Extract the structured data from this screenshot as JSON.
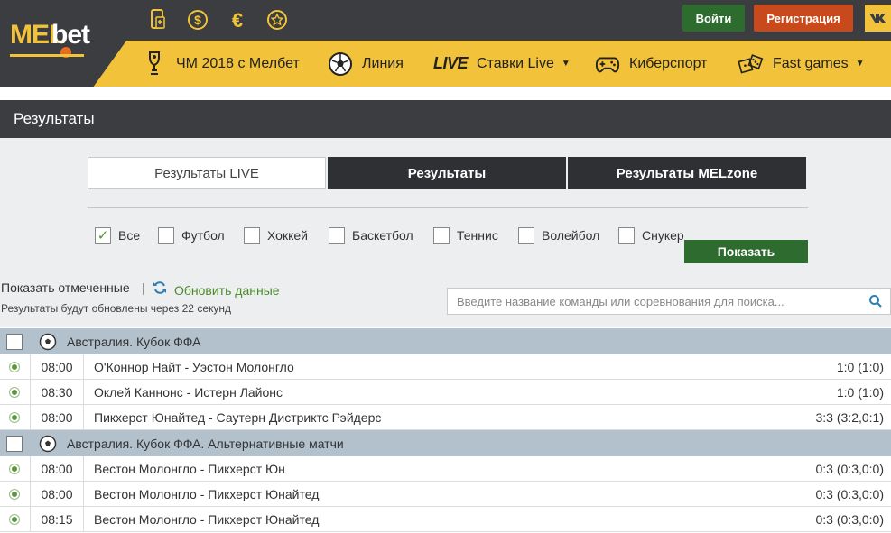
{
  "header": {
    "logo": {
      "mel": "MEL",
      "bet": "bet"
    },
    "top_icons": [
      "mobile-app-icon",
      "dollar-icon",
      "euro-icon",
      "star-icon"
    ],
    "login_label": "Войти",
    "register_label": "Регистрация",
    "vk_label": "VK",
    "nav": [
      {
        "label": "ЧМ 2018 с Мелбет",
        "icon": "trophy-icon"
      },
      {
        "label": "Линия",
        "icon": "soccer-ball-icon"
      },
      {
        "live_word": "LIVE",
        "label": "Ставки Live",
        "has_caret": true
      },
      {
        "label": "Киберспорт",
        "icon": "gamepad-icon"
      },
      {
        "label": "Fast games",
        "icon": "dice-icon",
        "has_caret": true
      }
    ]
  },
  "results": {
    "title": "Результаты",
    "tabs": [
      "Результаты LIVE",
      "Результаты",
      "Результаты MELzone"
    ],
    "filters": [
      {
        "label": "Все",
        "checked": true
      },
      {
        "label": "Футбол",
        "checked": false
      },
      {
        "label": "Хоккей",
        "checked": false
      },
      {
        "label": "Баскетбол",
        "checked": false
      },
      {
        "label": "Теннис",
        "checked": false
      },
      {
        "label": "Волейбол",
        "checked": false
      },
      {
        "label": "Снукер",
        "checked": false
      }
    ],
    "show_button": "Показать",
    "show_marked": "Показать отмеченные",
    "separator": "|",
    "refresh_label": "Обновить данные",
    "update_note": "Результаты будут обновлены через 22 секунд",
    "search_placeholder": "Введите название команды или соревнования для поиска..."
  },
  "groups": [
    {
      "name": "Австралия. Кубок ФФА",
      "matches": [
        {
          "time": "08:00",
          "teams": "О'Коннор Найт - Уэстон Молонгло",
          "score": "1:0 (1:0)"
        },
        {
          "time": "08:30",
          "teams": "Оклей Каннонс - Истерн Лайонс",
          "score": "1:0 (1:0)"
        },
        {
          "time": "08:00",
          "teams": "Пикхерст Юнайтед - Саутерн Дистриктс Рэйдерс",
          "score": "3:3 (3:2,0:1)"
        }
      ]
    },
    {
      "name": "Австралия. Кубок ФФА. Альтернативные матчи",
      "matches": [
        {
          "time": "08:00",
          "teams": "Вестон Молонгло - Пикхерст Юн",
          "score": "0:3 (0:3,0:0)"
        },
        {
          "time": "08:00",
          "teams": "Вестон Молонгло - Пикхерст Юнайтед",
          "score": "0:3 (0:3,0:0)"
        },
        {
          "time": "08:15",
          "teams": "Вестон Молонгло - Пикхерст Юнайтед",
          "score": "0:3 (0:3,0:0)"
        }
      ]
    }
  ]
}
